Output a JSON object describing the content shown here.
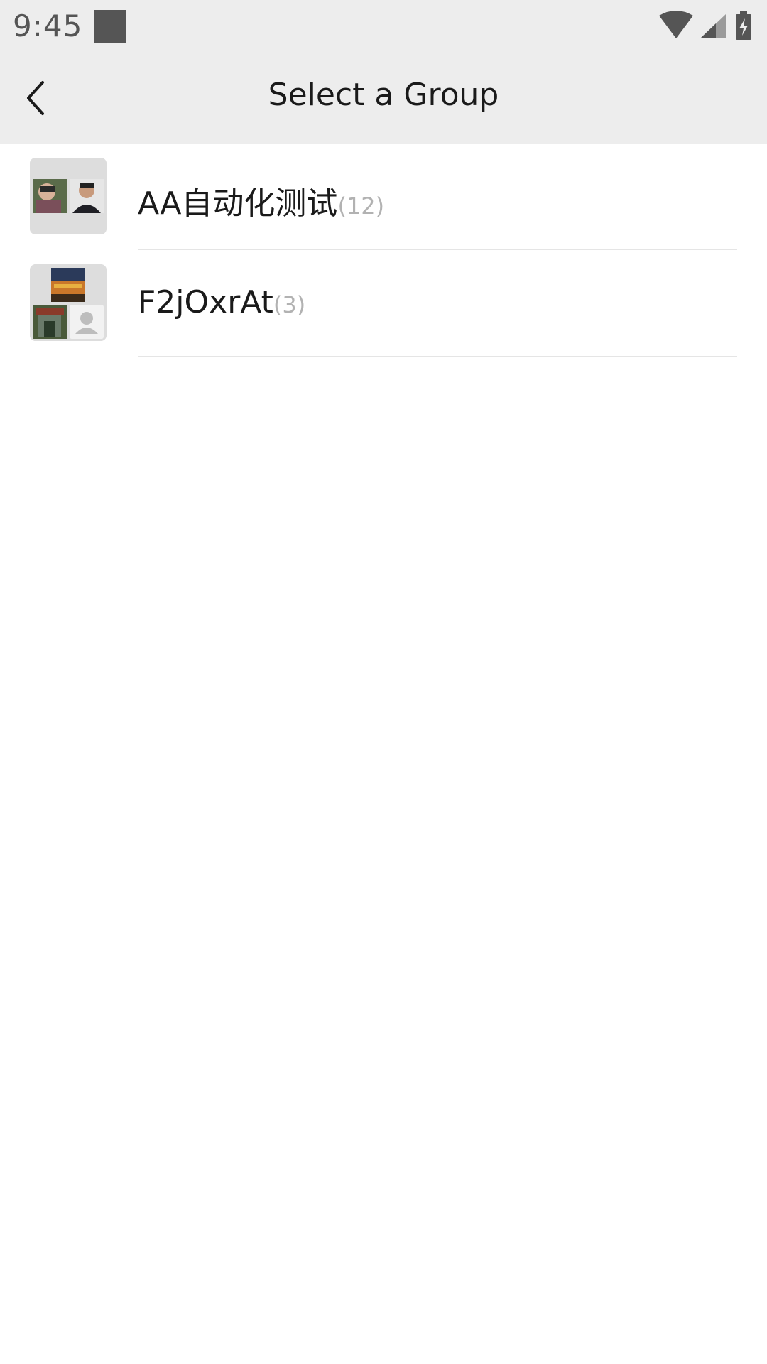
{
  "status_bar": {
    "time": "9:45",
    "icons": [
      "wifi-icon",
      "cell-signal-icon",
      "battery-charging-icon"
    ]
  },
  "header": {
    "title": "Select a Group",
    "back_icon": "chevron-left-icon"
  },
  "groups": [
    {
      "name": "AA自动化测试",
      "count": "(12)"
    },
    {
      "name": "F2jOxrAt",
      "count": "(3)"
    }
  ],
  "colors": {
    "bar_background": "#ededed",
    "page_background": "#ffffff",
    "primary_text": "#1a1a1a",
    "count_text": "#b2b2b2",
    "divider": "#e5e5e5"
  }
}
